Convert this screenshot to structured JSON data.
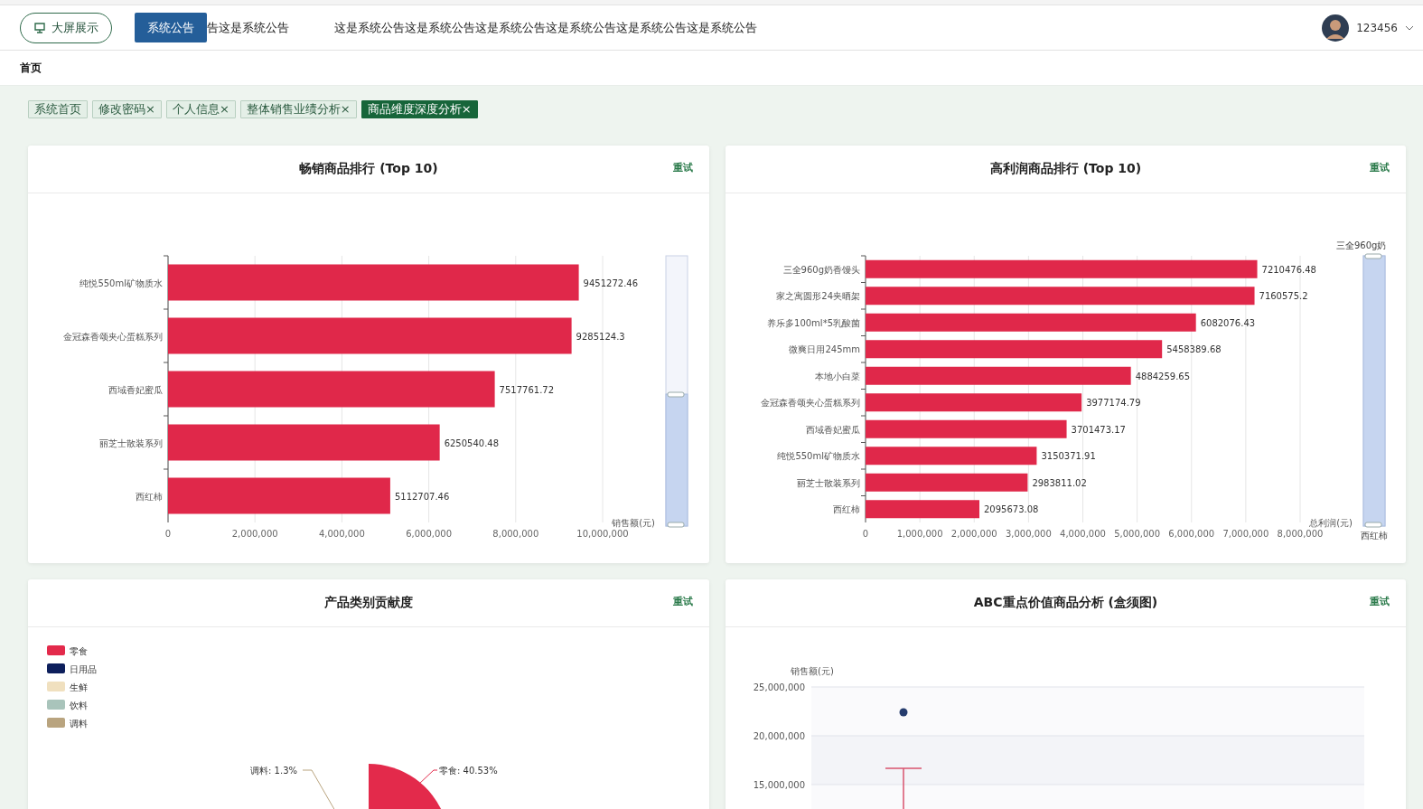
{
  "header": {
    "screen_button": "大屏展示",
    "notice_button": "系统公告",
    "notice_texts": [
      "告这是系统公告",
      "这是系统公告这是系统公告这是系统公告这是系统公告这是系统公告这是系统公告"
    ],
    "user": "123456"
  },
  "breadcrumb": "首页",
  "tabs": [
    {
      "label": "系统首页",
      "selected": false
    },
    {
      "label": "修改密码",
      "close": "×",
      "selected": false
    },
    {
      "label": "个人信息",
      "close": "×",
      "selected": false
    },
    {
      "label": "整体销售业绩分析",
      "close": "×",
      "selected": false
    },
    {
      "label": "商品维度深度分析",
      "close": "×",
      "selected": true
    }
  ],
  "cards": [
    {
      "kind": "bar",
      "title": "畅销商品排行 (Top 10)",
      "retry": "重试",
      "chart_data": {
        "type": "bar",
        "orientation": "horizontal",
        "grid": true,
        "xlabel": "销售额(元)",
        "categories": [
          "纯悦550ml矿物质水",
          "金冠森香颂夹心蛋糕系列",
          "西域香妃蜜瓜",
          "丽芝士散装系列",
          "西红柿"
        ],
        "series": [
          {
            "color": "#e0284a",
            "values": [
              9451272.46,
              9285124.3,
              7517761.72,
              6250540.48,
              5112707.46
            ]
          }
        ],
        "value_labels": [
          "9451272.46",
          "9285124.3",
          "7517761.72",
          "6250540.48",
          "5112707.46"
        ],
        "xlim": [
          0,
          10000000
        ],
        "xticks": [
          {
            "value": 0,
            "label": "0"
          },
          {
            "value": 2000000,
            "label": "2,000,000"
          },
          {
            "value": 4000000,
            "label": "4,000,000"
          },
          {
            "value": 6000000,
            "label": "6,000,000"
          },
          {
            "value": 8000000,
            "label": "8,000,000"
          },
          {
            "value": 10000000,
            "label": "10,000,000"
          }
        ]
      }
    },
    {
      "kind": "bar",
      "title": "高利润商品排行 (Top 10)",
      "retry": "重试",
      "zoom_labels": [
        "三全960g奶",
        "西红柿"
      ],
      "chart_data": {
        "type": "bar",
        "orientation": "horizontal",
        "grid": true,
        "xlabel": "总利润(元)",
        "categories": [
          "三全960g奶香馒头",
          "家之寓圆形24夹晒架",
          "养乐多100ml*5乳酸菌",
          "微爽日用245mm",
          "本地小白菜",
          "金冠森香颂夹心蛋糕系列",
          "西域香妃蜜瓜",
          "纯悦550ml矿物质水",
          "丽芝士散装系列",
          "西红柿"
        ],
        "series": [
          {
            "color": "#e0284a",
            "values": [
              7210476.48,
              7160575.2,
              6082076.43,
              5458389.68,
              4884259.65,
              3977174.79,
              3701473.17,
              3150371.91,
              2983811.02,
              2095673.08
            ]
          }
        ],
        "value_labels": [
          "7210476.48",
          "7160575.2",
          "6082076.43",
          "5458389.68",
          "4884259.65",
          "3977174.79",
          "3701473.17",
          "3150371.91",
          "2983811.02",
          "2095673.08"
        ],
        "xlim": [
          0,
          8000000
        ],
        "xticks": [
          {
            "value": 0,
            "label": "0"
          },
          {
            "value": 1000000,
            "label": "1,000,000"
          },
          {
            "value": 2000000,
            "label": "2,000,000"
          },
          {
            "value": 3000000,
            "label": "3,000,000"
          },
          {
            "value": 4000000,
            "label": "4,000,000"
          },
          {
            "value": 5000000,
            "label": "5,000,000"
          },
          {
            "value": 6000000,
            "label": "6,000,000"
          },
          {
            "value": 7000000,
            "label": "7,000,000"
          },
          {
            "value": 8000000,
            "label": "8,000,000"
          }
        ]
      }
    },
    {
      "kind": "pie",
      "title": "产品类别贡献度",
      "retry": "重试",
      "legend": [
        {
          "label": "零食",
          "color": "#e32a4b"
        },
        {
          "label": "日用品",
          "color": "#0d1f5c"
        },
        {
          "label": "生鲜",
          "color": "#f0e0bf"
        },
        {
          "label": "饮料",
          "color": "#a9c4bb"
        },
        {
          "label": "调料",
          "color": "#b9a47f"
        }
      ],
      "slice_labels": [
        "调料: 1.3%",
        "零食: 40.53%"
      ]
    },
    {
      "kind": "box",
      "title": "ABC重点价值商品分析 (盒须图)",
      "retry": "重试",
      "yaxis_name": "销售额(元)",
      "yticks": [
        "25,000,000",
        "20,000,000",
        "15,000,000"
      ]
    }
  ]
}
